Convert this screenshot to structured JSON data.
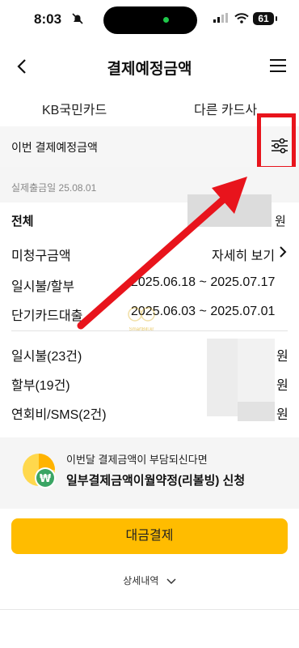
{
  "status_bar": {
    "time": "8:03",
    "battery": "61"
  },
  "header": {
    "title": "결제예정금액"
  },
  "tabs": [
    {
      "label": "KB국민카드"
    },
    {
      "label": "다른 카드사"
    }
  ],
  "section": {
    "title": "이번 결제예정금액"
  },
  "withdraw_date": "실제출금일 25.08.01",
  "rows": {
    "total": {
      "label": "전체",
      "unit": "원"
    },
    "unbilled": {
      "label": "미청구금액",
      "action": "자세히 보기"
    },
    "lump_installment": {
      "label": "일시불/할부",
      "period": "2025.06.18 ~ 2025.07.17"
    },
    "short_term_loan": {
      "label": "단기카드대출",
      "period": "2025.06.03 ~ 2025.07.01"
    },
    "lump_sum": {
      "label": "일시불(23건)",
      "unit": "원"
    },
    "installment": {
      "label": "할부(19건)",
      "unit": "원"
    },
    "annual_fee": {
      "label": "연회비/SMS(2건)",
      "unit": "원"
    }
  },
  "banner": {
    "subtitle": "이번달 결제금액이 부담되신다면",
    "link": "일부결제금액이월약정(리볼빙) 신청"
  },
  "pay_button": "대금결제",
  "details_toggle": "상세내역",
  "watermark": "SmartBill.kr",
  "colors": {
    "accent_yellow": "#ffbc00",
    "annotation_red": "#e8141c",
    "banner_green": "#3aa564"
  }
}
